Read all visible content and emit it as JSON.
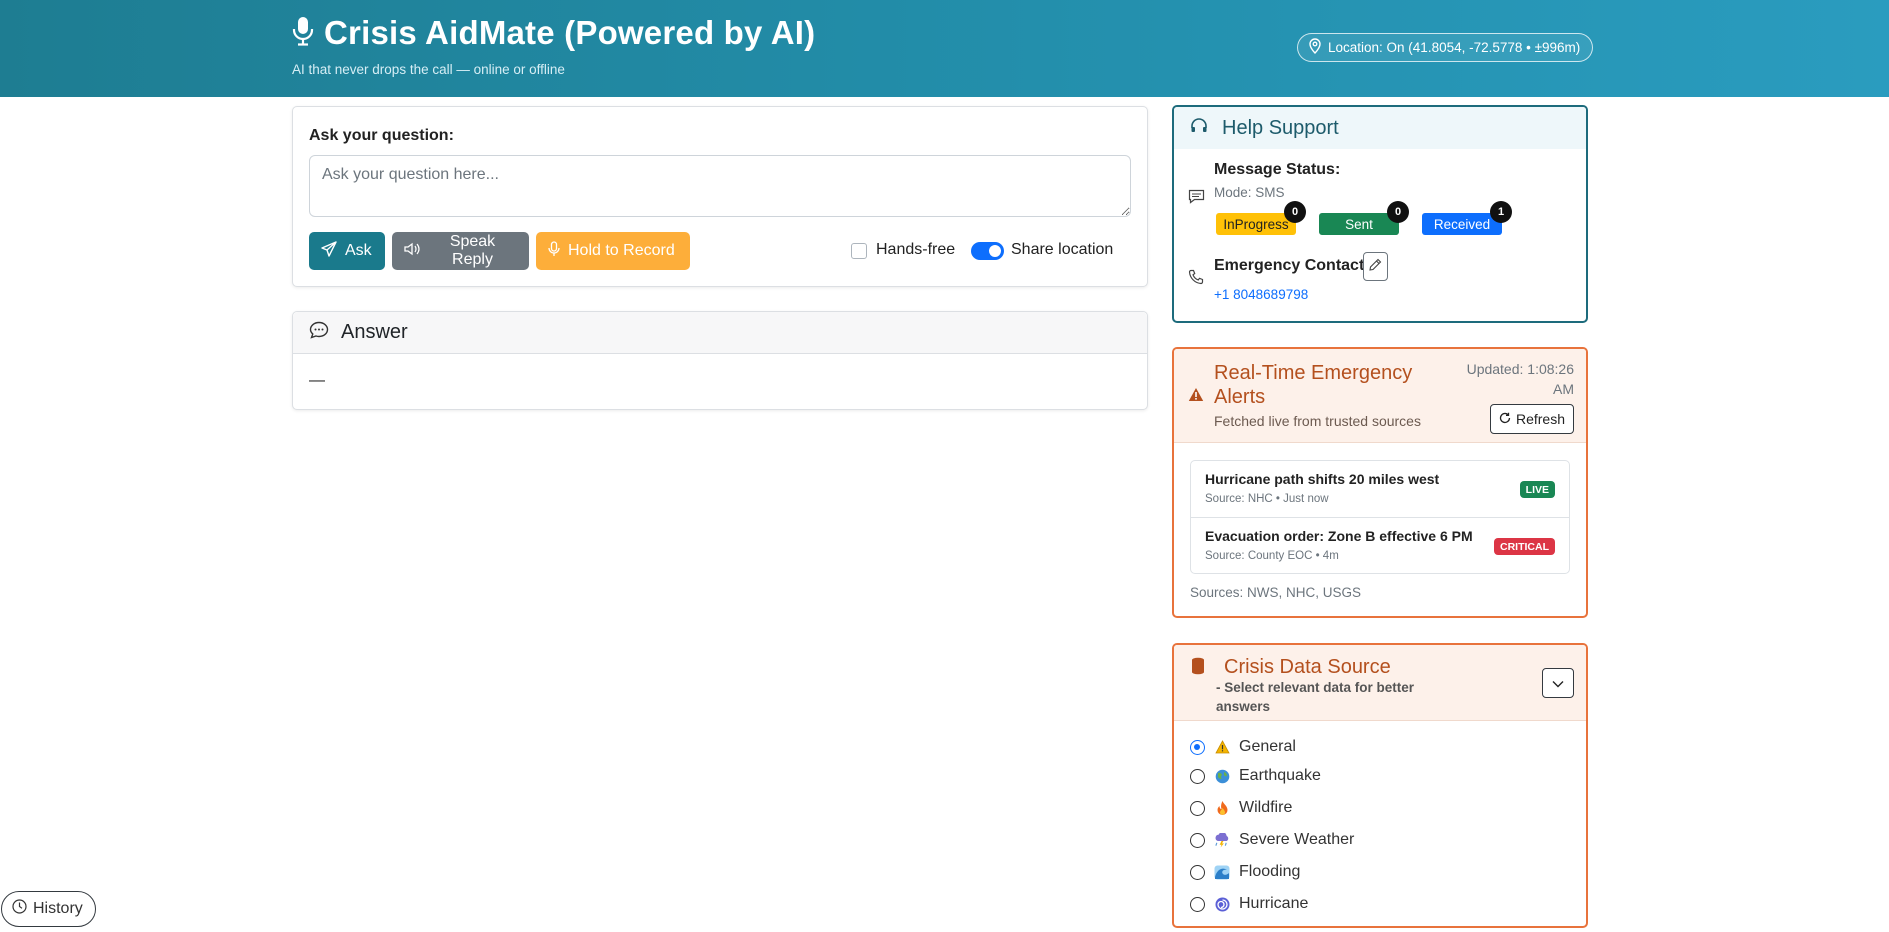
{
  "header": {
    "title": "Crisis AidMate (Powered by AI)",
    "subtitle": "AI that never drops the call — online or offline",
    "location": "Location: On (41.8054, -72.5778 • ±996m)"
  },
  "ask": {
    "label": "Ask your question:",
    "placeholder": "Ask your question here...",
    "ask_button": "Ask",
    "speak_button": "Speak Reply",
    "record_button": "Hold to Record",
    "handsfree_label": "Hands-free",
    "share_location_label": "Share location"
  },
  "answer": {
    "title": "Answer",
    "body": "—"
  },
  "help": {
    "title": "Help Support",
    "message_status_title": "Message Status:",
    "mode": "Mode: SMS",
    "badges": [
      {
        "label": "InProgress",
        "count": "0"
      },
      {
        "label": "Sent",
        "count": "0"
      },
      {
        "label": "Received",
        "count": "1"
      }
    ],
    "emergency_contact_title": "Emergency Contact",
    "emergency_number": "+1 8048689798"
  },
  "alerts": {
    "title": "Real-Time Emergency Alerts",
    "subtitle": "Fetched live from trusted sources",
    "updated": "Updated: 1:08:26 AM",
    "refresh_label": "Refresh",
    "items": [
      {
        "title": "Hurricane path shifts 20 miles west",
        "meta": "Source: NHC • Just now",
        "tag": "LIVE"
      },
      {
        "title": "Evacuation order: Zone B effective 6 PM",
        "meta": "Source: County EOC • 4m",
        "tag": "CRITICAL"
      }
    ],
    "sources": "Sources: NWS, NHC, USGS"
  },
  "crisis": {
    "title": "Crisis Data Source",
    "subtitle": "- Select relevant data for better answers",
    "options": [
      {
        "label": "General",
        "icon": "warning-icon",
        "selected": true
      },
      {
        "label": "Earthquake",
        "icon": "globe-icon",
        "selected": false
      },
      {
        "label": "Wildfire",
        "icon": "fire-icon",
        "selected": false
      },
      {
        "label": "Severe Weather",
        "icon": "storm-icon",
        "selected": false
      },
      {
        "label": "Flooding",
        "icon": "wave-icon",
        "selected": false
      },
      {
        "label": "Hurricane",
        "icon": "cyclone-icon",
        "selected": false
      }
    ]
  },
  "history": {
    "label": "History"
  },
  "colors": {
    "header_start": "#1e7d92",
    "header_end": "#2a9cbf",
    "accent_teal": "#1a7a8c",
    "alert_orange": "#e8733c",
    "live_green": "#198754",
    "critical_red": "#dc3545",
    "primary_blue": "#0d6efd"
  }
}
